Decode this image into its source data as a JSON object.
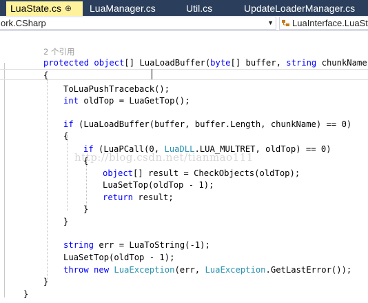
{
  "tabs": [
    {
      "label": "LuaState.cs",
      "active": true
    },
    {
      "label": "LuaManager.cs",
      "active": false
    },
    {
      "label": "Util.cs",
      "active": false
    },
    {
      "label": "UpdateLoaderManager.cs",
      "active": false
    }
  ],
  "tab_close_glyph": "⊕",
  "navigation": {
    "type_scope": "ork.CSharp",
    "member_scope": "LuaInterface.LuaSta"
  },
  "codelens": "2 个引用",
  "watermark": "http://blog.csdn.net/tianmao111",
  "code": {
    "signature": {
      "kw1": "protected",
      "kw2": "object",
      "t1": "[] LuaLoadBuffer(",
      "kw3": "byte",
      "t2": "[] buffer, ",
      "kw4": "string",
      "t3": " chunkName)"
    },
    "open_brace": "{",
    "push_traceback": "ToLuaPushTraceback();",
    "old_top": {
      "kw": "int",
      "rest": " oldTop = LuaGetTop();"
    },
    "if_load": {
      "kw": "if",
      "rest": " (LuaLoadBuffer(buffer, buffer.Length, chunkName) == 0)"
    },
    "inner_open": "{",
    "if_pcall": {
      "kw": "if",
      "a": " (LuaPCall(0, ",
      "ty": "LuaDLL",
      "b": ".LUA_MULTRET, oldTop) == 0)"
    },
    "pcall_open": "{",
    "result_line": {
      "kw": "object",
      "rest": "[] result = CheckObjects(oldTop);"
    },
    "set_top_1": "LuaSetTop(oldTop - 1);",
    "return_line": {
      "kw": "return",
      "rest": " result;"
    },
    "pcall_close": "}",
    "inner_close": "}",
    "err_line": {
      "kw": "string",
      "rest": " err = LuaToString(-1);"
    },
    "set_top_2": "LuaSetTop(oldTop - 1);",
    "throw_line": {
      "kw1": "throw",
      "kw2": " new ",
      "ty1": "LuaException",
      "a": "(err, ",
      "ty2": "LuaException",
      "b": ".GetLastError());"
    },
    "close_brace": "}",
    "class_close": "}"
  }
}
